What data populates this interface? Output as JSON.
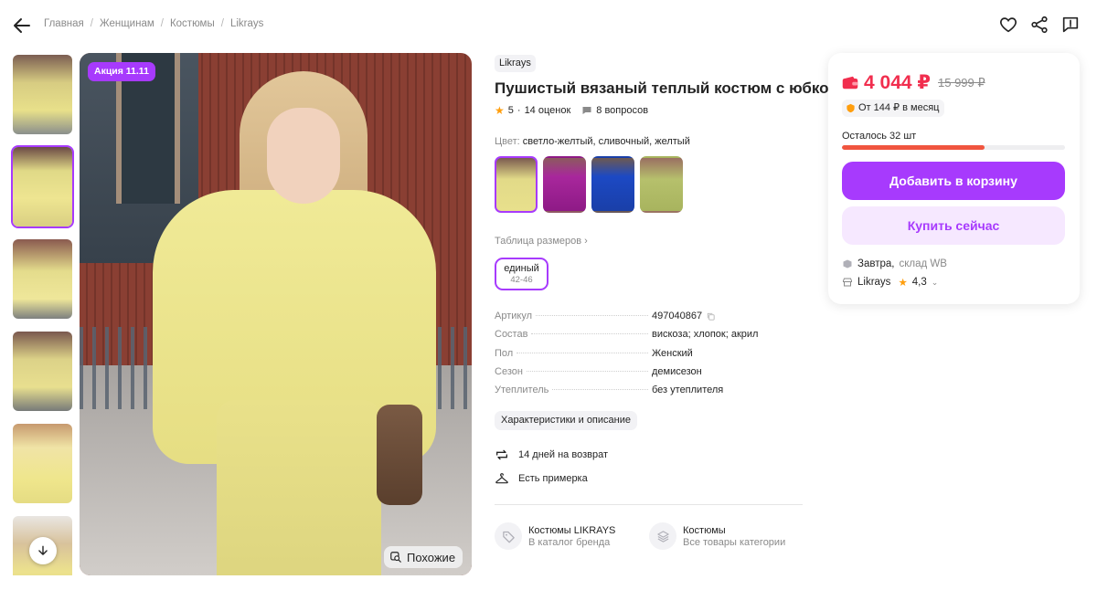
{
  "breadcrumbs": [
    "Главная",
    "Женщинам",
    "Костюмы",
    "Likrays"
  ],
  "gallery": {
    "promo_badge": "Акция 11.11",
    "similar_label": "Похожие",
    "thumbnails_count": 6,
    "active_thumbnail": 2
  },
  "product": {
    "brand": "Likrays",
    "title": "Пушистый вязаный теплый костюм с юбкой",
    "rating": "5",
    "reviews": "14 оценок",
    "questions": "8 вопросов",
    "color_label": "Цвет:",
    "color_value": "светло-желтый, сливочный, желтый",
    "swatch_colors": [
      "#e2da88",
      "#a8279c",
      "#1c49c4",
      "#b6c06c"
    ],
    "size_table_label": "Таблица размеров",
    "size": {
      "name": "единый",
      "range": "42-46"
    },
    "specs": [
      {
        "key": "Артикул",
        "value": "497040867"
      },
      {
        "key": "Состав",
        "value": "вискоза; хлопок; акрил"
      },
      {
        "key": "Пол",
        "value": "Женский"
      },
      {
        "key": "Сезон",
        "value": "демисезон"
      },
      {
        "key": "Утеплитель",
        "value": "без утеплителя"
      }
    ],
    "characteristics_button": "Характеристики и описание",
    "features": [
      "14 дней на возврат",
      "Есть примерка"
    ],
    "links": [
      {
        "title": "Костюмы LIKRAYS",
        "subtitle": "В каталог бренда"
      },
      {
        "title": "Костюмы",
        "subtitle": "Все товары категории"
      }
    ]
  },
  "buy_box": {
    "price": "4 044 ₽",
    "old_price": "15 999 ₽",
    "installment": "От 144 ₽ в месяц",
    "stock_label": "Осталось 32 шт",
    "stock_fraction": 0.64,
    "add_to_cart": "Добавить в корзину",
    "buy_now": "Купить сейчас",
    "delivery_day": "Завтра,",
    "delivery_warehouse": "склад WB",
    "seller_name": "Likrays",
    "seller_rating": "4,3"
  },
  "colors": {
    "accent": "#a73afd",
    "price": "#f12e4e",
    "star": "#ff9e0d"
  }
}
